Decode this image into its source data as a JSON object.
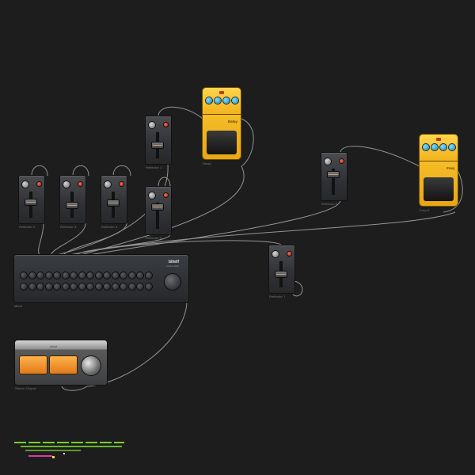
{
  "canvas": {
    "background": "#1d1d1d"
  },
  "modules": {
    "faders": [
      {
        "id": "f1",
        "caption": "Reflector 1"
      },
      {
        "id": "f2",
        "caption": "Reflector 2"
      },
      {
        "id": "f3",
        "caption": "Reflector 3"
      },
      {
        "id": "f4",
        "caption": "Reflector 4"
      },
      {
        "id": "f5",
        "caption": "Reflector 5"
      },
      {
        "id": "f6",
        "caption": "Reflector 6"
      },
      {
        "id": "f7",
        "caption": "Reflector 7"
      }
    ],
    "pedals": [
      {
        "id": "p1",
        "caption": "Delay",
        "label": "Delay"
      },
      {
        "id": "p2",
        "caption": "Freq E",
        "label": "Freq"
      }
    ],
    "mixer": {
      "caption": "Mixer",
      "brand": "bitwif",
      "sub": "mixing desk"
    },
    "vu": {
      "caption": "Stereo Output",
      "logo": "bitwif"
    }
  },
  "colors": {
    "cable": "#a9a9a9",
    "pedal": "#f5bd28",
    "knob_blue": "#2a9ad6",
    "led_red": "#d42a1d",
    "legend_green": "#76d12e",
    "legend_pink": "#d93aa8",
    "legend_yellow": "#f2d23a"
  },
  "icons": [
    "fader-knob-icon",
    "led-icon",
    "jack-icon"
  ]
}
